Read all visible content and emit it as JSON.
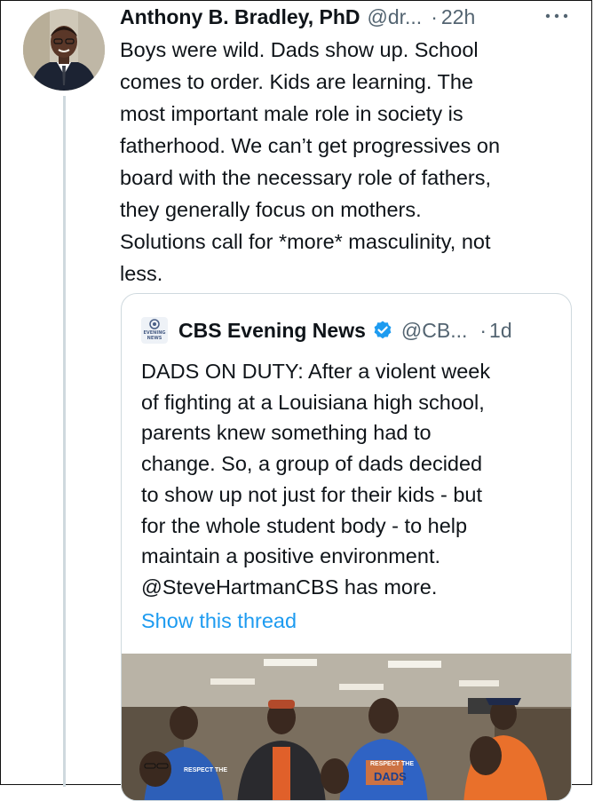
{
  "tweet": {
    "author_name": "Anthony B. Bradley, PhD",
    "handle": "@dr...",
    "dot": "·",
    "time": "22h",
    "more_icon": "more-horizontal-icon",
    "lines": [
      "Boys were wild. Dads show up. School",
      "comes to order. Kids are learning. The",
      "most important male role in society is",
      "fatherhood. We can’t get progressives on",
      "board with the necessary role of fathers,",
      "they generally focus on mothers.",
      "Solutions call for *more* masculinity, not",
      "less."
    ]
  },
  "quote": {
    "logo_text": "CBS EVENING NEWS",
    "name": "CBS Evening News",
    "verified_icon": "verified-badge-icon",
    "handle": "@CB...",
    "dot": "·",
    "time": "1d",
    "lines": [
      "DADS ON DUTY: After a violent week",
      "of fighting at a Louisiana high school,",
      "parents knew something had to",
      "change. So, a group of dads decided",
      "to show up not just for their kids - but",
      "for the whole student body - to help",
      "maintain a positive environment.",
      "@SteveHartmanCBS has more."
    ],
    "show_thread": "Show this thread",
    "shirt_text_1": "RESPECT THE",
    "shirt_text_2": "DADS"
  },
  "colors": {
    "link": "#1d9bf0",
    "secondary_text": "#536471",
    "primary_text": "#0f1419",
    "verified": "#1d9bf0",
    "border": "#cfd9de"
  }
}
